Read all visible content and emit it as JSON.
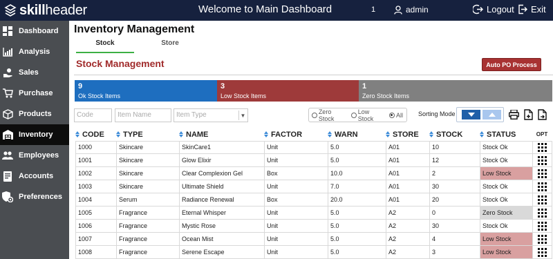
{
  "topbar": {
    "brand_bold": "skill",
    "brand_rest": "header",
    "title": "Welcome to Main Dashboard",
    "count": "1",
    "user": "admin",
    "logout": "Logout",
    "exit": "Exit"
  },
  "sidebar": {
    "items": [
      {
        "label": "Dashboard",
        "icon": "grid-icon"
      },
      {
        "label": "Analysis",
        "icon": "chart-icon"
      },
      {
        "label": "Sales",
        "icon": "hand-coins-icon"
      },
      {
        "label": "Purchase",
        "icon": "cart-icon"
      },
      {
        "label": "Products",
        "icon": "box-icon"
      },
      {
        "label": "Inventory",
        "icon": "warehouse-icon"
      },
      {
        "label": "Employees",
        "icon": "users-icon"
      },
      {
        "label": "Accounts",
        "icon": "ledger-icon"
      },
      {
        "label": "Preferences",
        "icon": "shield-gear-icon"
      }
    ],
    "active": "Inventory"
  },
  "main": {
    "title": "Inventory Management",
    "tabs": [
      {
        "label": "Stock"
      },
      {
        "label": "Store"
      }
    ],
    "active_tab": "Stock",
    "section_title": "Stock Management",
    "auto_po_label": "Auto PO Process"
  },
  "summary": {
    "ok": {
      "count": "9",
      "label": "Ok Stock Items",
      "color": "#1e6ebf"
    },
    "low": {
      "count": "3",
      "label": "Low Stock Items",
      "color": "#9e3a3a"
    },
    "zero": {
      "count": "1",
      "label": "Zero Stock Items",
      "color": "#808080"
    }
  },
  "filters": {
    "code_placeholder": "Code",
    "item_name_placeholder": "Item Name",
    "item_type_placeholder": "Item Type",
    "radio_options": [
      "Zero Stock",
      "Low Stock",
      "All"
    ],
    "radio_selected": "All",
    "sorting_label": "Sorting Mode"
  },
  "table": {
    "columns": [
      "CODE",
      "TYPE",
      "NAME",
      "FACTOR",
      "WARN",
      "STORE",
      "STOCK",
      "STATUS",
      "OPT"
    ],
    "rows": [
      {
        "code": "1000",
        "type": "Skincare",
        "name": "SkinCare1",
        "factor": "Unit",
        "warn": "5.0",
        "store": "A01",
        "stock": "10",
        "status": "Stock Ok",
        "state": "ok"
      },
      {
        "code": "1001",
        "type": "Skincare",
        "name": "Glow Elixir",
        "factor": "Unit",
        "warn": "5.0",
        "store": "A01",
        "stock": "12",
        "status": "Stock Ok",
        "state": "ok"
      },
      {
        "code": "1002",
        "type": "Skincare",
        "name": "Clear Complexion Gel",
        "factor": "Box",
        "warn": "10.0",
        "store": "A01",
        "stock": "2",
        "status": "Low Stock",
        "state": "low"
      },
      {
        "code": "1003",
        "type": "Skincare",
        "name": "Ultimate Shield",
        "factor": "Unit",
        "warn": "7.0",
        "store": "A01",
        "stock": "30",
        "status": "Stock Ok",
        "state": "ok"
      },
      {
        "code": "1004",
        "type": "Serum",
        "name": "Radiance Renewal",
        "factor": "Box",
        "warn": "20.0",
        "store": "A01",
        "stock": "20",
        "status": "Stock Ok",
        "state": "ok"
      },
      {
        "code": "1005",
        "type": "Fragrance",
        "name": "Eternal Whisper",
        "factor": "Unit",
        "warn": "5.0",
        "store": "A2",
        "stock": "0",
        "status": "Zero Stock",
        "state": "zero"
      },
      {
        "code": "1006",
        "type": "Fragrance",
        "name": "Mystic Rose",
        "factor": "Unit",
        "warn": "5.0",
        "store": "A2",
        "stock": "30",
        "status": "Stock Ok",
        "state": "ok"
      },
      {
        "code": "1007",
        "type": "Fragrance",
        "name": "Ocean Mist",
        "factor": "Unit",
        "warn": "5.0",
        "store": "A2",
        "stock": "4",
        "status": "Low Stock",
        "state": "low"
      },
      {
        "code": "1008",
        "type": "Fragrance",
        "name": "Serene Escape",
        "factor": "Unit",
        "warn": "5.0",
        "store": "A2",
        "stock": "3",
        "status": "Low Stock",
        "state": "low"
      }
    ]
  }
}
